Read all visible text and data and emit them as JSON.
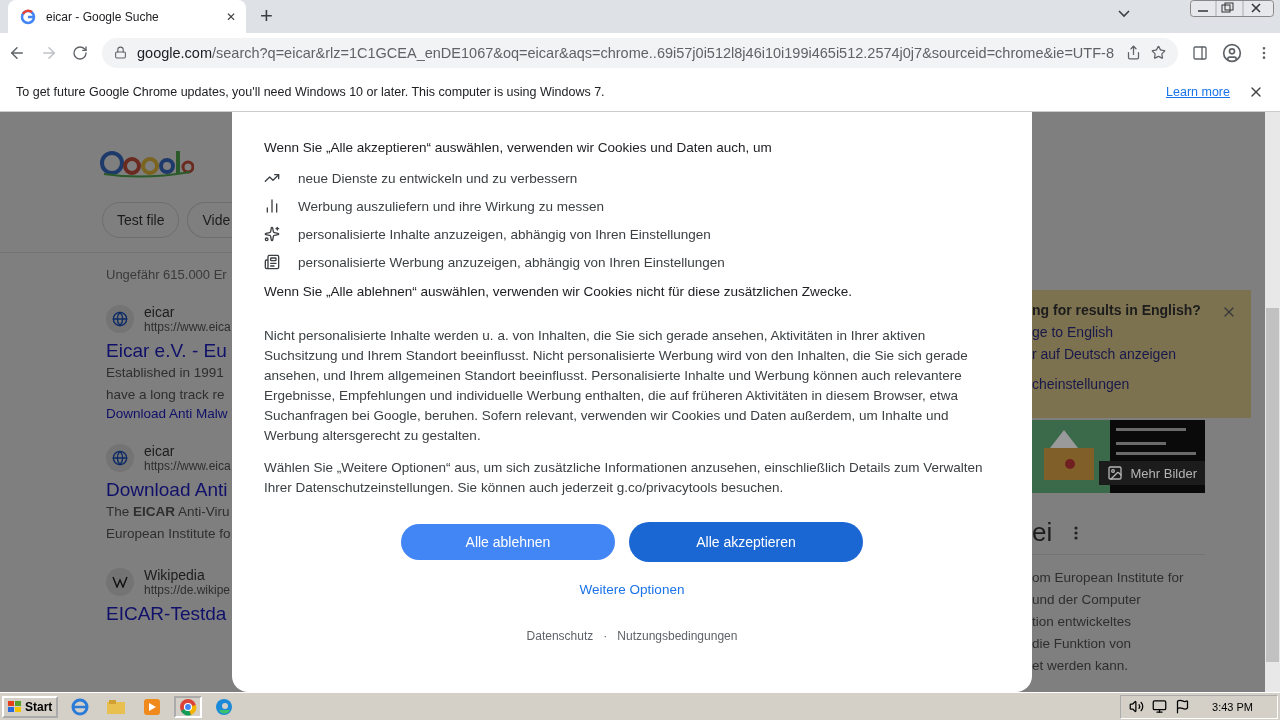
{
  "browser": {
    "tab": {
      "title": "eicar - Google Suche",
      "close": "✕"
    },
    "new_tab": "+",
    "url_host": "google.com",
    "url_rest": "/search?q=eicar&rlz=1C1GCEA_enDE1067&oq=eicar&aqs=chrome..69i57j0i512l8j46i10i199i465i512.2574j0j7&sourceid=chrome&ie=UTF-8"
  },
  "infobar": {
    "message": "To get future Google Chrome updates, you'll need Windows 10 or later. This computer is using Windows 7.",
    "link": "Learn more"
  },
  "page": {
    "chips": [
      "Test file",
      "Vide"
    ],
    "result_count": "Ungefähr 615.000 Er",
    "results": [
      {
        "kind": "globe",
        "source": "eicar",
        "url": "https://www.eica",
        "title": "Eicar e.V. - Eu",
        "snippet": [
          "Established in 1991",
          "have a long track re"
        ],
        "link": "Download Anti Malw"
      },
      {
        "kind": "globe",
        "source": "eicar",
        "url": "https://www.eica",
        "title": "Download Anti",
        "snippet": [
          "The **EICAR** Anti-Viru",
          "European Institute fo"
        ]
      },
      {
        "kind": "wiki",
        "source": "Wikipedia",
        "url": "https://de.wikipe",
        "title": "EICAR-Testda"
      }
    ],
    "language_box": {
      "heading": "ng for results in English?",
      "links": [
        "ge to English",
        "r auf Deutsch anzeigen",
        "cheinstellungen"
      ]
    },
    "more_images": "Mehr Bilder",
    "panel_title": "ei",
    "panel_text": [
      "om European Institute for",
      "und der Computer",
      "tion entwickeltes",
      "die Funktion von",
      "et werden kann."
    ]
  },
  "dialog": {
    "intro": "Wenn Sie „Alle akzeptieren“ auswählen, verwenden wir Cookies und Daten auch, um",
    "items": [
      {
        "kind": "trend",
        "text": "neue Dienste zu entwickeln und zu verbessern"
      },
      {
        "kind": "bars",
        "text": "Werbung auszuliefern und ihre Wirkung zu messen"
      },
      {
        "kind": "sparkle",
        "text": "personalisierte Inhalte anzuzeigen, abhängig von Ihren Einstellungen"
      },
      {
        "kind": "news",
        "text": "personalisierte Werbung anzuzeigen, abhängig von Ihren Einstellungen"
      }
    ],
    "decline_note": "Wenn Sie „Alle ablehnen“ auswählen, verwenden wir Cookies nicht für diese zusätzlichen Zwecke.",
    "paragraphs": [
      "Nicht personalisierte Inhalte werden u. a. von Inhalten, die Sie sich gerade ansehen, Aktivitäten in Ihrer aktiven Suchsitzung und Ihrem Standort beeinflusst. Nicht personalisierte Werbung wird von den Inhalten, die Sie sich gerade ansehen, und Ihrem allgemeinen Standort beeinflusst. Personalisierte Inhalte und Werbung können auch relevantere Ergebnisse, Empfehlungen und individuelle Werbung enthalten, die auf früheren Aktivitäten in diesem Browser, etwa Suchanfragen bei Google, beruhen. Sofern relevant, verwenden wir Cookies und Daten außerdem, um Inhalte und Werbung altersgerecht zu gestalten.",
      "Wählen Sie „Weitere Optionen“ aus, um sich zusätzliche Informationen anzusehen, einschließlich Details zum Verwalten Ihrer Datenschutzeinstellungen. Sie können auch jederzeit g.co/privacytools besuchen."
    ],
    "buttons": [
      {
        "label": "Alle ablehnen",
        "kind": "secondary"
      },
      {
        "label": "Alle akzeptieren",
        "kind": "primary"
      }
    ],
    "more_options": "Weitere Optionen",
    "footer_links": [
      "Datenschutz",
      "Nutzungsbedingungen"
    ],
    "footer_separator": "·"
  },
  "taskbar": {
    "start": "Start",
    "clock": "3:43 PM"
  }
}
